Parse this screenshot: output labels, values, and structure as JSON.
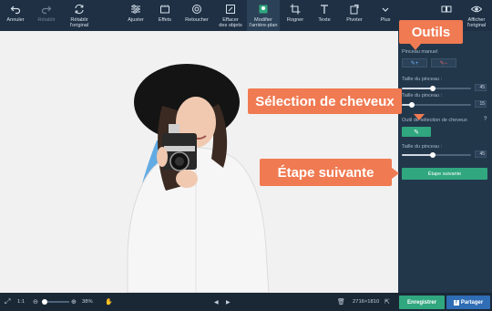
{
  "toolbar": {
    "undo": "Annuler",
    "redo": "Rétablir",
    "reset": "Rétablir\nl'original",
    "adjust": "Ajuster",
    "effects": "Effets",
    "retouch": "Retoucher",
    "remove_objects": "Effacer\ndes objets",
    "change_background": "Modifier\nl'arrière-plan",
    "crop": "Rogner",
    "text": "Texte",
    "rotate": "Pivoter",
    "more": "Plus",
    "show_original": "Afficher\nl'original"
  },
  "panel": {
    "manual_brush_label": "Pinceau manuel",
    "brush_size_label_1": "Taille du pinceau :",
    "brush_size_value_1": "45",
    "brush_size_label_2": "Taille du pinceau :",
    "brush_size_value_2": "15",
    "hair_tool_label": "Outil de sélection de cheveux",
    "brush_size_label_3": "Taille du pinceau :",
    "brush_size_value_3": "45",
    "next_step_button": "Étape suivante",
    "brush_size_1_fraction": 0.45,
    "brush_size_2_fraction": 0.15,
    "brush_size_3_fraction": 0.45
  },
  "callouts": {
    "tools": "Outils",
    "hair_selection": "Sélection de cheveux",
    "next_step": "Étape suivante"
  },
  "bottom": {
    "fit": "1:1",
    "zoom": "38%",
    "dimensions": "2716×1810",
    "save": "Enregistrer",
    "share": "Partager"
  },
  "colors": {
    "accent_green": "#30a77f",
    "callout_orange": "#f07a52",
    "share_blue": "#2f6db5",
    "hair_selection_blue": "#4a9fe0"
  }
}
